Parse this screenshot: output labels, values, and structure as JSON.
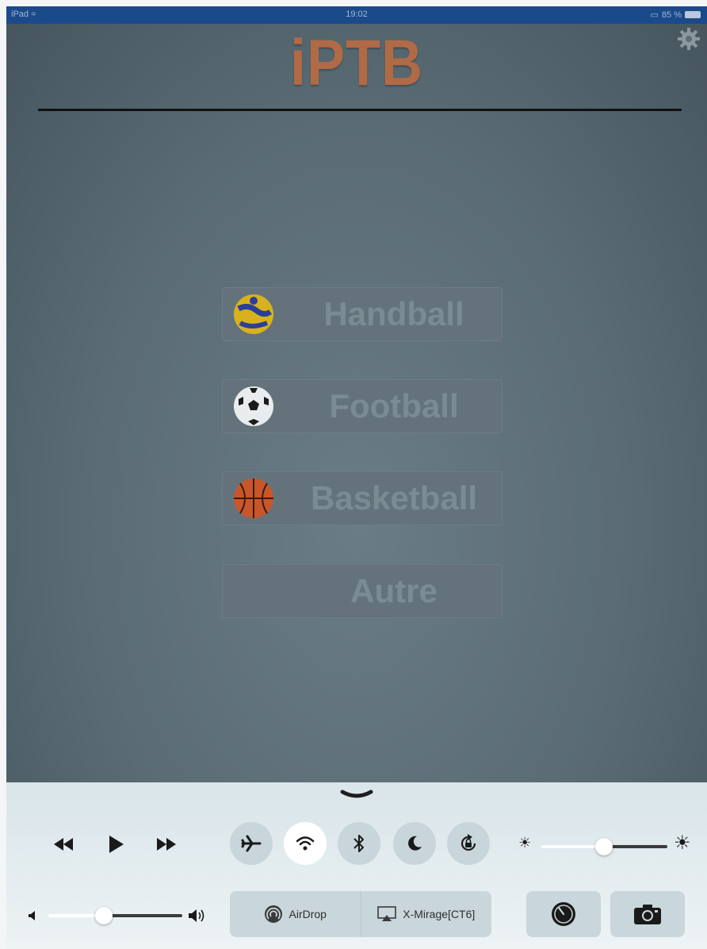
{
  "status_bar": {
    "device": "iPad",
    "time": "19:02",
    "battery": "85 %"
  },
  "app": {
    "logo": "iPTB",
    "settings_icon": "gear-icon"
  },
  "sports": [
    {
      "label": "Handball",
      "icon": "handball-icon"
    },
    {
      "label": "Football",
      "icon": "football-icon"
    },
    {
      "label": "Basketball",
      "icon": "basketball-icon"
    },
    {
      "label": "Autre",
      "icon": ""
    }
  ],
  "control_center": {
    "media": [
      "rewind-icon",
      "play-icon",
      "fast-forward-icon"
    ],
    "toggles": [
      {
        "icon": "airplane-icon",
        "on": false
      },
      {
        "icon": "wifi-icon",
        "on": true
      },
      {
        "icon": "bluetooth-icon",
        "on": false
      },
      {
        "icon": "moon-icon",
        "on": false
      },
      {
        "icon": "rotation-lock-icon",
        "on": false
      }
    ],
    "brightness_level": 0.5,
    "volume_level": 0.42,
    "airdrop_label": "AirDrop",
    "airplay_label": "X-Mirage[CT6]",
    "timer_icon": "timer-icon",
    "camera_icon": "camera-icon"
  },
  "colors": {
    "status_bar": "#1b4a8a",
    "logo": "#b06a46",
    "app_background": "#5a6b74"
  }
}
